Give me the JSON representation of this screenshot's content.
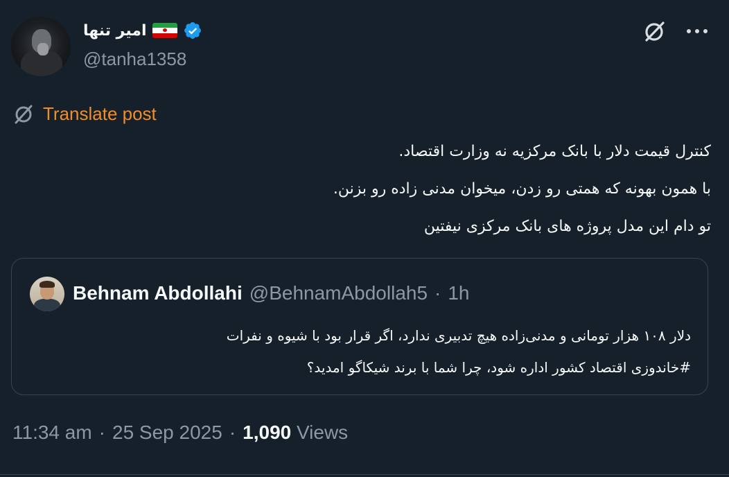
{
  "author": {
    "display_name": "امیر تنها",
    "handle": "@tanha1358",
    "verified": true,
    "flag": "Iran flag"
  },
  "translate": {
    "label": "Translate post",
    "color": "#f28c28"
  },
  "post": {
    "lines": [
      "کنترل قیمت دلار با بانک مرکزیه نه وزارت اقتصاد.",
      "با همون بهونه که همتی رو زدن، میخوان مدنی زاده رو بزنن.",
      "تو دام این مدل پروژه های بانک مرکزی نیفتین"
    ]
  },
  "quote": {
    "name": "Behnam Abdollahi",
    "handle": "@BehnamAbdollah5",
    "separator": "·",
    "time": "1h",
    "lines": [
      "دلار ۱۰۸ هزار تومانی و مدنی‌زاده هیچ تدبیری ندارد، اگر قرار بود با شیوه و نفرات",
      "#خاندوزی اقتصاد کشور اداره شود، چرا شما با برند شیکاگو امدید؟"
    ]
  },
  "footer": {
    "time": "11:34 am",
    "sep1": "·",
    "date": "25 Sep 2025",
    "sep2": "·",
    "views_count": "1,090",
    "views_label": "Views"
  },
  "icons": {
    "grok": "grok-icon",
    "more": "more-icon",
    "translate": "translate-icon",
    "verified": "verified-badge-icon"
  },
  "colors": {
    "background": "#15202b",
    "text": "#f7f9f9",
    "muted": "#8b98a5",
    "verified": "#1d9bf0",
    "border": "#38444d"
  }
}
